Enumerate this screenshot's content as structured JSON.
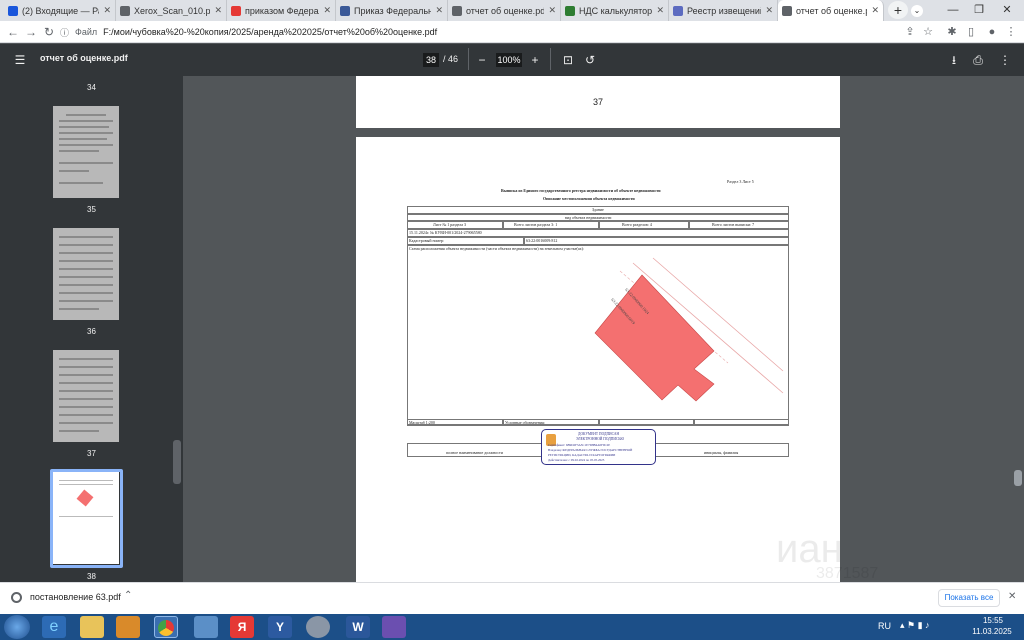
{
  "tabs": [
    {
      "label": "(2) Входящие — Рамб",
      "icon_color": "#1a56db",
      "icon": "mail-icon"
    },
    {
      "label": "Xerox_Scan_010.pdf",
      "icon_color": "#5f6368",
      "icon": "globe-icon"
    },
    {
      "label": "приказом Федеральн",
      "icon_color": "#e53935",
      "icon": "yandex-icon"
    },
    {
      "label": "Приказ Федерально",
      "icon_color": "#3b5998",
      "icon": "flag-icon"
    },
    {
      "label": "отчет об оценке.pdf",
      "icon_color": "#5f6368",
      "icon": "globe-icon"
    },
    {
      "label": "НДС калькулятор онл",
      "icon_color": "#2e7d32",
      "icon": "calc-icon"
    },
    {
      "label": "Реестр извещений",
      "icon_color": "#5c6bc0",
      "icon": "registry-icon"
    },
    {
      "label": "отчет об оценке.pdf",
      "icon_color": "#5f6368",
      "icon": "globe-icon"
    }
  ],
  "address": {
    "file_label": "Файл",
    "url": "F:/мои/чубовка%20-%20копия/2025/аренда%202025/отчет%20об%20оценке.pdf"
  },
  "pdf": {
    "title": "отчет об оценке.pdf",
    "page": "38",
    "total": "/ 46",
    "zoom": "100%"
  },
  "thumbs": [
    {
      "num": "34"
    },
    {
      "num": "35"
    },
    {
      "num": "36"
    },
    {
      "num": "37"
    },
    {
      "num": "38"
    }
  ],
  "page37": {
    "number": "37"
  },
  "doc": {
    "section": "Раздел 3     Лист 5",
    "heading": "Выписка из Единого государственного реестра недвижимости об объекте недвижимости",
    "subheading": "Описание местоположения объекта недвижимости",
    "type": "Здание",
    "type_caption": "вид объекта недвижимости",
    "sheet": "Лист № 1 раздела 3",
    "sheets_sec": "Всего листов раздела 3: 1",
    "sections": "Всего разделов: 4",
    "sheets_total": "Всего листов выписки: 7",
    "date_no": "15.11.2024г. № КУВИ-001/2024-279065580",
    "cad_label": "Кадастровый номер:",
    "cad_value": "63:22:0016009:812",
    "scheme_label": "Схема расположения объекта недвижимости (части объекта недвижимости) на земельном участке(ах):",
    "parcel1": "63:22:0000000:1924",
    "parcel2": "63:22:0000000:6019",
    "scale": "Масштаб 1:200",
    "legend": "Условные обозначения:",
    "position": "полное наименование должности",
    "initials": "инициалы, фамилия",
    "stamp1": "ДОКУМЕНТ ПОДПИСАН",
    "stamp2": "ЭЛЕКТРОННОЙ ПОДПИСЬЮ",
    "stamp3": "Сертификат: 6B9D2F3A5C1E7D8B4A0F9C2E",
    "stamp4": "Владелец: ФЕДЕРАЛЬНАЯ СЛУЖБА ГОСУДАРСТВЕННОЙ",
    "stamp5": "РЕГИСТРАЦИИ, КАДАСТРА И КАРТОГРАФИИ",
    "stamp6": "Действителен: с 09.02.2024 по 05.05.2025"
  },
  "watermark": {
    "text1": "иан",
    "text2": "3871587"
  },
  "download": {
    "file": "постановление 63.pdf",
    "show_all": "Показать все"
  },
  "tray": {
    "lang": "RU",
    "time": "15:55",
    "date": "11.03.2025"
  },
  "colors": {
    "building": "#f47070",
    "stamp": "#33338a",
    "chrome": "#323639"
  }
}
